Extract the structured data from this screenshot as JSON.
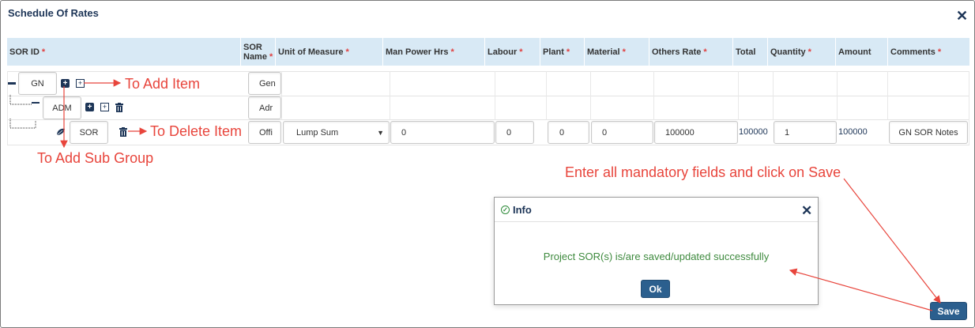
{
  "modal": {
    "title": "Schedule Of Rates",
    "close_icon": "close-icon"
  },
  "table": {
    "headers": [
      {
        "label": "SOR ID",
        "required": "*"
      },
      {
        "label": "SOR Name",
        "required": "*"
      },
      {
        "label": "Unit of Measure",
        "required": "*"
      },
      {
        "label": "Man Power Hrs",
        "required": "*"
      },
      {
        "label": "Labour",
        "required": "*"
      },
      {
        "label": "Plant",
        "required": "*"
      },
      {
        "label": "Material",
        "required": "*"
      },
      {
        "label": "Others Rate",
        "required": "*"
      },
      {
        "label": "Total",
        "required": ""
      },
      {
        "label": "Quantity",
        "required": "*"
      },
      {
        "label": "Amount",
        "required": ""
      },
      {
        "label": "Comments",
        "required": "*"
      }
    ],
    "sor_name_line1": "SOR",
    "sor_name_line2": "Name",
    "row_group": {
      "sor_id": "GN",
      "sor_name": "Gen"
    },
    "row_subgroup": {
      "sor_id": "ADM",
      "sor_name": "Adr"
    },
    "row_item": {
      "sor_id": "SOR",
      "sor_name": "Offi",
      "unit": "Lump Sum",
      "man_power_hrs": "0",
      "labour": "0",
      "plant": "0",
      "material": "0",
      "others_rate": "100000",
      "total": "100000",
      "quantity": "1",
      "amount": "100000",
      "comments": "GN SOR Notes"
    }
  },
  "annotations": {
    "add_item": "To Add Item",
    "delete_item": "To Delete Item",
    "add_sub_group": "To Add Sub Group",
    "save_hint": "Enter all mandatory fields and click on Save"
  },
  "dialog": {
    "title": "Info",
    "message": "Project SOR(s) is/are saved/updated successfully",
    "ok_label": "Ok"
  },
  "footer": {
    "save_label": "Save"
  },
  "colors": {
    "header_bg": "#d8e9f5",
    "primary": "#2b5f8e",
    "annotation": "#e8453c",
    "success": "#3e8a3e"
  }
}
